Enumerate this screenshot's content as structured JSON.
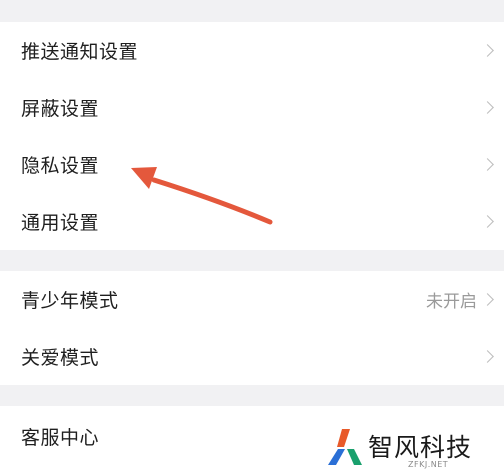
{
  "settings": {
    "group1": {
      "items": [
        {
          "label": "推送通知设置",
          "icon": "chevron-right-icon"
        },
        {
          "label": "屏蔽设置",
          "icon": "chevron-right-icon"
        },
        {
          "label": "隐私设置",
          "icon": "chevron-right-icon"
        },
        {
          "label": "通用设置",
          "icon": "chevron-right-icon"
        }
      ]
    },
    "group2": {
      "items": [
        {
          "label": "青少年模式",
          "value": "未开启",
          "icon": "chevron-right-icon"
        },
        {
          "label": "关爱模式",
          "icon": "chevron-right-icon"
        }
      ]
    },
    "group3": {
      "items": [
        {
          "label": "客服中心"
        }
      ]
    }
  },
  "annotation": {
    "type": "arrow",
    "color": "#e4583c",
    "points_to": "隐私设置"
  },
  "watermark": {
    "brand": "智风科技",
    "domain": "ZFKJ.NET",
    "logo_colors": [
      "#e85a2a",
      "#2a6fd6",
      "#1aa06d"
    ]
  },
  "colors": {
    "background": "#f1f1f3",
    "surface": "#ffffff",
    "text": "#1f1f1f",
    "secondary_text": "#9a9a9a",
    "chevron": "#bdbdbd"
  }
}
